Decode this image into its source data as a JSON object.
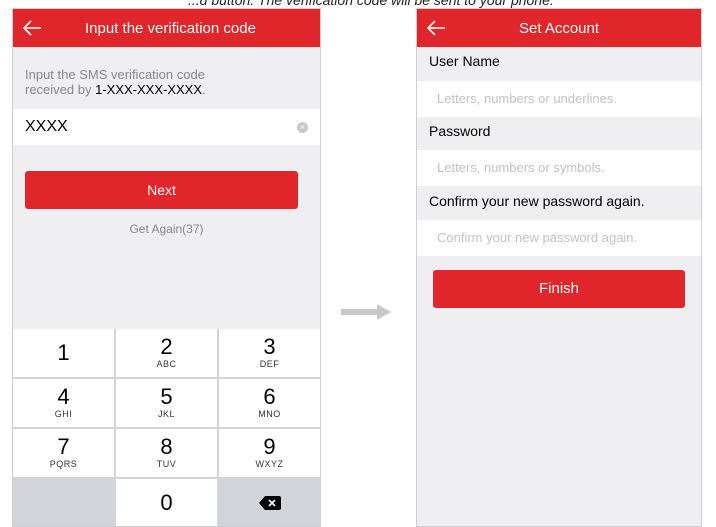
{
  "caption": "...d button. The verification code will be sent to your phone.",
  "left": {
    "title": "Input the verification code",
    "hint_prefix": "Input the SMS verification code",
    "hint_received_by": "received by ",
    "hint_phone": "1-XXX-XXX-XXXX",
    "hint_suffix": ".",
    "code_value": "XXXX",
    "next_label": "Next",
    "get_again_label": "Get Again(37)",
    "keys": [
      {
        "num": "1",
        "letters": ""
      },
      {
        "num": "2",
        "letters": "ABC"
      },
      {
        "num": "3",
        "letters": "DEF"
      },
      {
        "num": "4",
        "letters": "GHI"
      },
      {
        "num": "5",
        "letters": "JKL"
      },
      {
        "num": "6",
        "letters": "MNO"
      },
      {
        "num": "7",
        "letters": "PQRS"
      },
      {
        "num": "8",
        "letters": "TUV"
      },
      {
        "num": "9",
        "letters": "WXYZ"
      },
      {
        "num": "0",
        "letters": ""
      }
    ]
  },
  "right": {
    "title": "Set Account",
    "user_name_label": "User Name",
    "user_name_placeholder": "Letters, numbers or underlines.",
    "password_label": "Password",
    "password_placeholder": "Letters, numbers or symbols.",
    "confirm_label": "Confirm your new password again.",
    "confirm_placeholder": "Confirm your new password again.",
    "finish_label": "Finish"
  },
  "colors": {
    "accent": "#e0262a",
    "background": "#efeff1",
    "arrow": "#c8c8c8"
  },
  "icons": [
    "back-arrow-icon",
    "clear-icon",
    "delete-icon",
    "right-arrow-icon"
  ]
}
